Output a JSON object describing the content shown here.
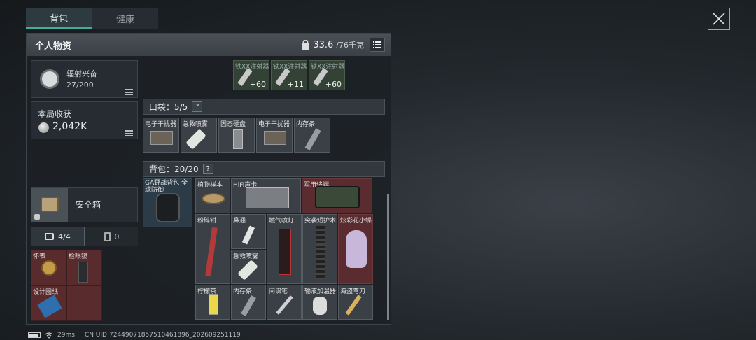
{
  "tabs": {
    "backpack": "背包",
    "health": "健康"
  },
  "panel": {
    "title": "个人物资",
    "weight_current": "33.6",
    "weight_max": "/76千克"
  },
  "radiation": {
    "name": "辐射兴奋",
    "value": "27/200"
  },
  "earnings": {
    "label": "本局收获",
    "value": "2,042K"
  },
  "safe_box": {
    "label": "安全箱"
  },
  "kit_tabs": {
    "tools": "4/4",
    "batteries": "0"
  },
  "kit_items": [
    {
      "label": "怀表"
    },
    {
      "label": "检眼镜"
    },
    {
      "label": "设计图纸"
    },
    {
      "label": ""
    }
  ],
  "ammo_cells": [
    {
      "label": "铁XX注射器",
      "count": "+60"
    },
    {
      "label": "铁XX注射器",
      "count": "+11"
    },
    {
      "label": "铁XX注射器",
      "count": "+60"
    }
  ],
  "pocket": {
    "label": "口袋：5/5",
    "items": [
      "电子干扰器",
      "急救喷雾",
      "固态硬盘",
      "电子干扰器",
      "内存条"
    ]
  },
  "backpack": {
    "label": "背包：20/20",
    "bag_name": "GA野战背包 全球防御",
    "items": [
      "植物样本",
      "HiFi声卡",
      "军用终端",
      "粉碎钳",
      "鼻通",
      "燃气喷灯",
      "突袭短护木",
      "炫彩花小蝶",
      "急救喷雾",
      "柠檬茶",
      "内存条",
      "间谍笔",
      "输液加温器",
      "海盗弯刀"
    ]
  },
  "status": {
    "ping": "29ms",
    "uid": "CN UID:72449071857510461896_202609251119"
  },
  "colors": {
    "accent": "#3fae9a",
    "rare_red": "#5a2c2f",
    "panel": "#1c2125"
  }
}
